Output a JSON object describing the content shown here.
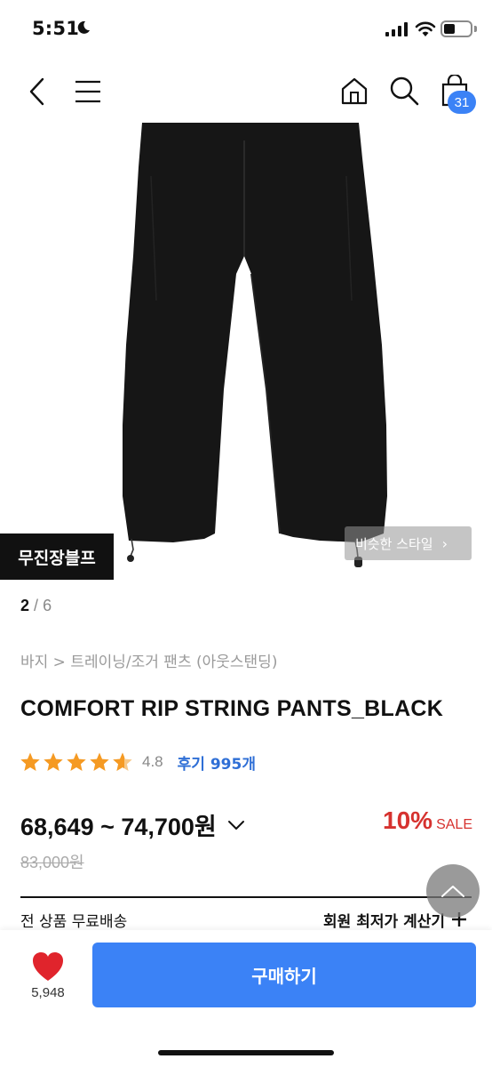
{
  "status_bar": {
    "time": "5:51"
  },
  "nav": {
    "cart_count": "31"
  },
  "image": {
    "brand_tag": "무진장블프",
    "similar_style": "비슷한 스타일",
    "page_current": "2",
    "page_separator": "/",
    "page_total": "6"
  },
  "product": {
    "breadcrumb": "바지 > 트레이닝/조거 팬츠 (아웃스탠딩)",
    "title": "COMFORT RIP STRING PANTS_BLACK",
    "rating": "4.8",
    "review_label": "후기 995개",
    "price_range": "68,649 ~ 74,700원",
    "discount_percent": "10%",
    "discount_label": "SALE",
    "original_price": "83,000원",
    "shipping_text": "전 상품 무료배송",
    "member_price_text": "회원 최저가 계산기"
  },
  "bottom": {
    "like_count": "5,948",
    "buy_label": "구매하기"
  },
  "colors": {
    "accent": "#3b82f6",
    "sale": "#d6322f",
    "star": "#f59a23",
    "heart": "#e0242c"
  }
}
